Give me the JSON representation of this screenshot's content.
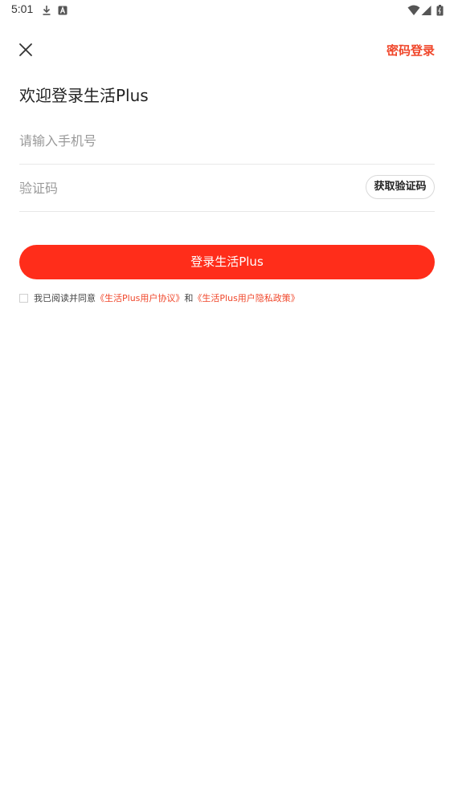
{
  "status_bar": {
    "time": "5:01",
    "icons": [
      "download-icon",
      "a-badge-icon",
      "wifi-icon",
      "signal-icon",
      "battery-icon"
    ]
  },
  "header": {
    "close_icon": "close-icon",
    "password_login": "密码登录"
  },
  "title": "欢迎登录生活Plus",
  "form": {
    "phone_placeholder": "请输入手机号",
    "phone_value": "",
    "code_placeholder": "验证码",
    "code_value": "",
    "get_code_label": "获取验证码",
    "login_label": "登录生活Plus"
  },
  "agreement": {
    "checked": false,
    "prefix": "我已阅读并同意",
    "user_agreement": "《生活Plus用户协议》",
    "and": "和",
    "privacy_policy": "《生活Plus用户隐私政策》"
  },
  "colors": {
    "accent": "#f0472b",
    "button": "#ff2d1a"
  }
}
